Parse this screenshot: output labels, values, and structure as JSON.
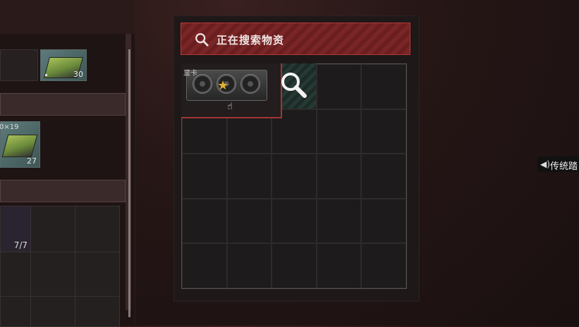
{
  "search": {
    "status_text": "正在搜索物资"
  },
  "left_inventory": {
    "items": [
      {
        "count": "30"
      },
      {
        "label": "0×19",
        "count": "27"
      }
    ],
    "sub_container": {
      "fraction": "7/7"
    }
  },
  "container": {
    "found_item": {
      "label": "显卡",
      "favorite": true
    },
    "grid": {
      "columns": 5,
      "rows": 5
    }
  },
  "voice_chip": {
    "label": "传统踏"
  },
  "icons": {
    "search_bar": "search-icon",
    "searching": "magnifier-icon",
    "favorite": "star-icon",
    "cursor": "hand-cursor-icon",
    "voice": "speaker-icon"
  },
  "colors": {
    "accent_red": "#a33535",
    "search_bar_bg": "#7a2526",
    "favorite_gold": "#e0b030",
    "searching_teal": "#253a34"
  }
}
